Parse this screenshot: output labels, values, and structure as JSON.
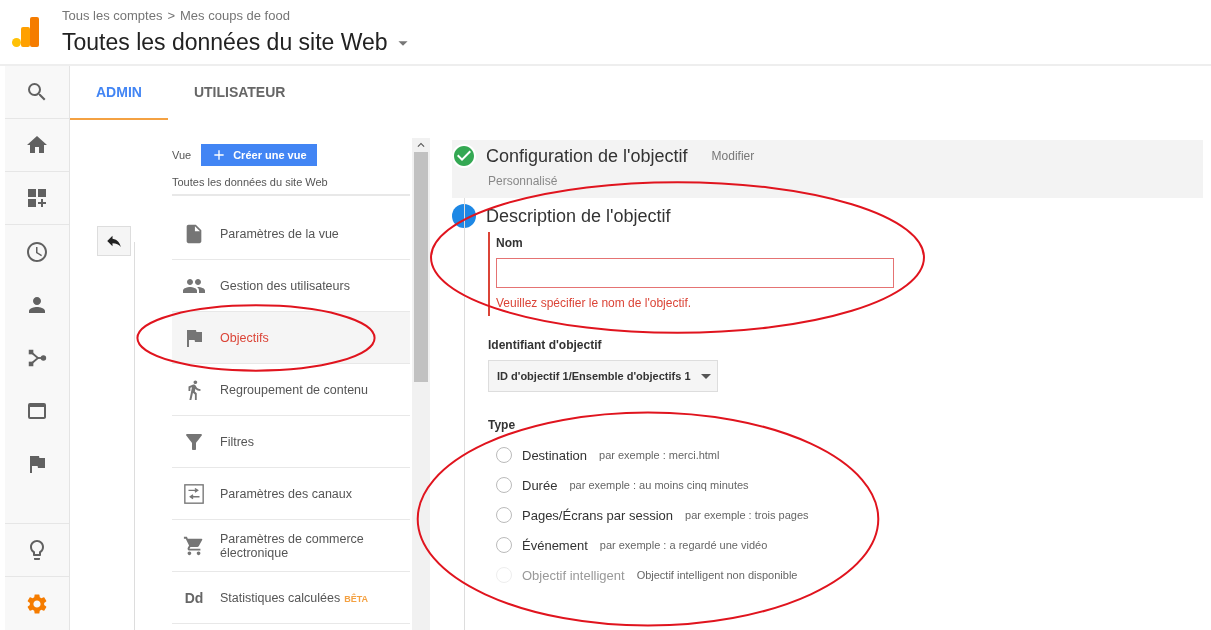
{
  "header": {
    "breadcrumb": [
      "Tous les comptes",
      "Mes coups de food"
    ],
    "breadcrumb_separator": ">",
    "title": "Toutes les données du site Web"
  },
  "rail": [
    {
      "selected": false
    },
    {
      "selected": false
    },
    {
      "selected": false
    },
    {
      "selected": false
    },
    {
      "selected": false
    },
    {
      "selected": false
    },
    {
      "selected": false
    },
    {
      "selected": false
    },
    {
      "selected": false
    },
    {
      "selected": true
    }
  ],
  "tabs": [
    {
      "label": "ADMIN",
      "selected": true
    },
    {
      "label": "UTILISATEUR",
      "selected": false
    }
  ],
  "view": {
    "label": "Vue",
    "create_button": "Créer une vue",
    "current": "Toutes les données du site Web"
  },
  "menu": [
    {
      "label": "Paramètres de la vue",
      "selected": false,
      "circled": false
    },
    {
      "label": "Gestion des utilisateurs",
      "selected": false,
      "circled": false
    },
    {
      "label": "Objectifs",
      "selected": true,
      "circled": true
    },
    {
      "label": "Regroupement de contenu",
      "selected": false,
      "circled": false
    },
    {
      "label": "Filtres",
      "selected": false,
      "circled": false
    },
    {
      "label": "Paramètres des canaux",
      "selected": false,
      "circled": false
    },
    {
      "label": "Paramètres de commerce électronique",
      "selected": false,
      "circled": false
    },
    {
      "label": "Statistiques calculées",
      "icon_text": "Dd",
      "badge": "BÊTA",
      "selected": false,
      "circled": false
    }
  ],
  "steps": [
    {
      "completed": true,
      "title": "Configuration de l'objectif",
      "action": "Modifier",
      "summary": "Personnalisé"
    },
    {
      "completed": false,
      "title": "Description de l'objectif"
    }
  ],
  "name_field": {
    "label": "Nom",
    "error": "Veuillez spécifier le nom de l'objectif.",
    "circled": true
  },
  "goal_id": {
    "label": "Identifiant d'objectif",
    "value": "ID d'objectif 1/Ensemble d'objectifs 1"
  },
  "type": {
    "label": "Type",
    "circled": true,
    "options": [
      {
        "label": "Destination",
        "hint": "par exemple : merci.html",
        "selected": false,
        "disabled": false
      },
      {
        "label": "Durée",
        "hint": "par exemple : au moins cinq minutes",
        "selected": false,
        "disabled": false
      },
      {
        "label": "Pages/Écrans par session",
        "hint": "par exemple : trois pages",
        "selected": false,
        "disabled": false
      },
      {
        "label": "Événement",
        "hint": "par exemple : a regardé une vidéo",
        "selected": false,
        "disabled": false
      },
      {
        "label": "Objectif intelligent",
        "hint": "Objectif intelligent non disponible",
        "selected": false,
        "disabled": true
      }
    ]
  }
}
